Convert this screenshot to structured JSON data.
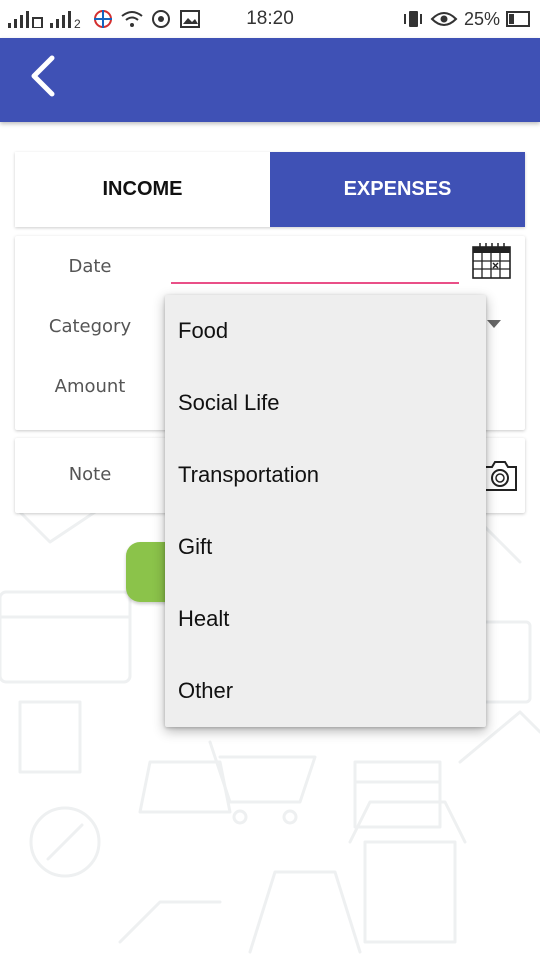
{
  "status_bar": {
    "time": "18:20",
    "battery": "25%",
    "network_label": "2"
  },
  "app_bar": {
    "back_icon": "chevron-left-icon"
  },
  "tabs": [
    {
      "label": "INCOME",
      "selected": false
    },
    {
      "label": "EXPENSES",
      "selected": true
    }
  ],
  "form": {
    "date_label": "Date",
    "date_value": "",
    "category_label": "Category",
    "amount_label": "Amount",
    "note_label": "Note"
  },
  "category_dropdown": {
    "options": [
      "Food",
      "Social Life",
      "Transportation",
      "Gift",
      "Healt",
      "Other"
    ]
  },
  "colors": {
    "primary": "#3f51b5",
    "accent_underline": "#e94f87",
    "save_button": "#8bc34a",
    "dropdown_bg": "#eeeeee"
  }
}
